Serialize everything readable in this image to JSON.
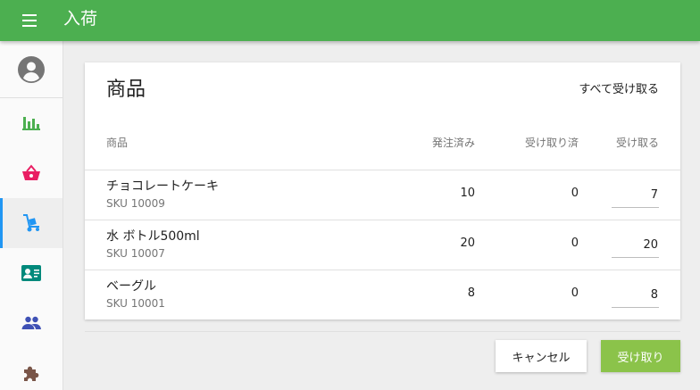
{
  "appbar": {
    "title": "入荷",
    "menu_icon": "menu-icon"
  },
  "sidebar": {
    "profile_icon": "account-circle-icon",
    "items": [
      {
        "name": "analytics",
        "icon": "bar-chart-icon",
        "color": "#4caf50",
        "active": false
      },
      {
        "name": "orders",
        "icon": "shopping-basket-icon",
        "color": "#e91e63",
        "active": false
      },
      {
        "name": "receiving",
        "icon": "hand-truck-icon",
        "color": "#2196f3",
        "active": true
      },
      {
        "name": "contacts",
        "icon": "contact-card-icon",
        "color": "#00897b",
        "active": false
      },
      {
        "name": "users",
        "icon": "people-icon",
        "color": "#3f51b5",
        "active": false
      },
      {
        "name": "extensions",
        "icon": "puzzle-icon",
        "color": "#795548",
        "active": false
      }
    ]
  },
  "card": {
    "title": "商品",
    "receive_all_label": "すべて受け取る",
    "headers": {
      "name": "商品",
      "ordered": "発注済み",
      "received": "受け取り済",
      "receive": "受け取る"
    },
    "rows": [
      {
        "name": "チョコレートケーキ",
        "sku": "SKU 10009",
        "ordered": "10",
        "received": "0",
        "receive": "7"
      },
      {
        "name": "水 ボトル500ml",
        "sku": "SKU 10007",
        "ordered": "20",
        "received": "0",
        "receive": "20"
      },
      {
        "name": "ベーグル",
        "sku": "SKU 10001",
        "ordered": "8",
        "received": "0",
        "receive": "8"
      }
    ]
  },
  "actions": {
    "cancel_label": "キャンセル",
    "receive_label": "受け取り"
  },
  "colors": {
    "primary": "#4caf50",
    "accent": "#8bc34a",
    "active_indicator": "#2196f3"
  }
}
